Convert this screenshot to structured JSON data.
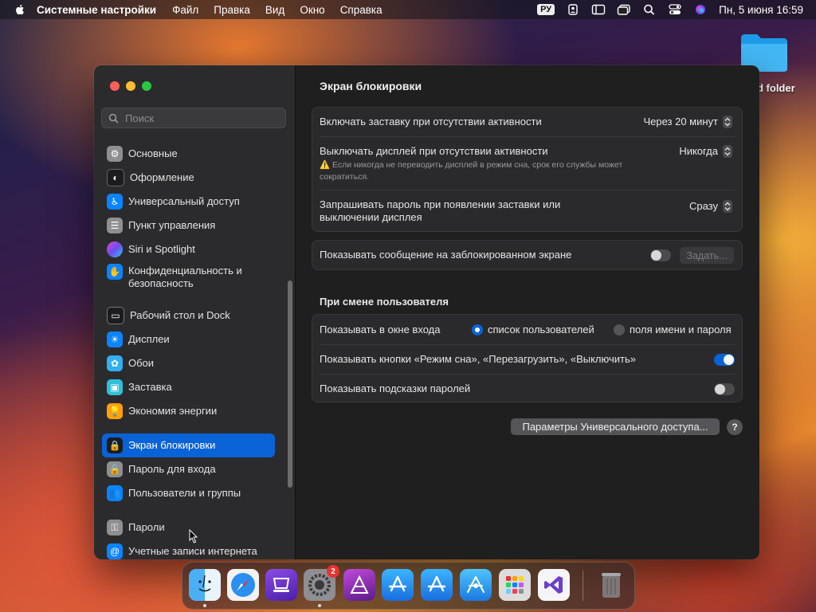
{
  "menubar": {
    "app_name": "Системные настройки",
    "items": [
      "Файл",
      "Правка",
      "Вид",
      "Окно",
      "Справка"
    ],
    "input_source": "РУ",
    "clock": "Пн, 5 июня  16:59"
  },
  "desktop": {
    "folder_label": "d folder"
  },
  "sidebar": {
    "search_placeholder": "Поиск",
    "items": [
      {
        "label": "Основные",
        "icon": "gear-icon",
        "color": "#8e8e93"
      },
      {
        "label": "Оформление",
        "icon": "appearance-icon",
        "color": "#1c1c1e"
      },
      {
        "label": "Универсальный доступ",
        "icon": "accessibility-icon",
        "color": "#0a84ff"
      },
      {
        "label": "Пункт управления",
        "icon": "control-center-icon",
        "color": "#8e8e93"
      },
      {
        "label": "Siri и Spotlight",
        "icon": "siri-icon",
        "color": "#b04aff"
      },
      {
        "label": "Конфиденциальность и безопасность",
        "icon": "hand-icon",
        "color": "#0a84ff"
      },
      {
        "label": "Рабочий стол и Dock",
        "icon": "dock-icon",
        "color": "#1c1c1e"
      },
      {
        "label": "Дисплеи",
        "icon": "sun-icon",
        "color": "#0a84ff"
      },
      {
        "label": "Обои",
        "icon": "wallpaper-icon",
        "color": "#30b0f0"
      },
      {
        "label": "Заставка",
        "icon": "screensaver-icon",
        "color": "#30c0d8"
      },
      {
        "label": "Экономия энергии",
        "icon": "bulb-icon",
        "color": "#ff9f0a"
      },
      {
        "label": "Экран блокировки",
        "icon": "lock-icon",
        "color": "#1c1c1e"
      },
      {
        "label": "Пароль для входа",
        "icon": "lock-icon",
        "color": "#8e8e93"
      },
      {
        "label": "Пользователи и группы",
        "icon": "users-icon",
        "color": "#0a84ff"
      },
      {
        "label": "Пароли",
        "icon": "key-icon",
        "color": "#8e8e93"
      },
      {
        "label": "Учетные записи интернета",
        "icon": "at-icon",
        "color": "#0a84ff"
      }
    ]
  },
  "main": {
    "title": "Экран блокировки",
    "screensaver_label": "Включать заставку при отсутствии активности",
    "screensaver_value": "Через 20 минут",
    "display_off_label": "Выключать дисплей при отсутствии активности",
    "display_off_value": "Никогда",
    "display_off_warning": "⚠️ Если никогда не переводить дисплей в режим сна, срок его службы может сократиться.",
    "password_label": "Запрашивать пароль при появлении заставки или выключении дисплея",
    "password_value": "Сразу",
    "message_label": "Показывать сообщение на заблокированном экране",
    "message_toggle": false,
    "message_button": "Задать...",
    "switch_section_title": "При смене пользователя",
    "login_window_label": "Показывать в окне входа",
    "login_option_list": "список пользователей",
    "login_option_fields": "поля имени и пароля",
    "login_selected": "список пользователей",
    "buttons_label": "Показывать кнопки «Режим сна», «Перезагрузить», «Выключить»",
    "buttons_toggle": true,
    "hints_label": "Показывать подсказки паролей",
    "hints_toggle": false,
    "accessibility_button": "Параметры Универсального доступа...",
    "help_button": "?"
  },
  "dock": {
    "apps": [
      {
        "name": "Finder",
        "icon": "finder-icon"
      },
      {
        "name": "Safari",
        "icon": "safari-icon"
      },
      {
        "name": "Apple Configurator",
        "icon": "configurator-icon"
      },
      {
        "name": "Системные настройки",
        "icon": "settings-icon",
        "badge": "2"
      },
      {
        "name": "Affinity Photo",
        "icon": "affinity-icon"
      },
      {
        "name": "App Store",
        "icon": "appstore-icon"
      },
      {
        "name": "Xcode Instruments",
        "icon": "appstore-alt-icon"
      },
      {
        "name": "TestFlight",
        "icon": "testflight-icon"
      },
      {
        "name": "Launchpad",
        "icon": "launchpad-icon"
      },
      {
        "name": "Visual Studio",
        "icon": "visual-studio-icon"
      },
      {
        "name": "Корзина",
        "icon": "trash-icon"
      }
    ]
  }
}
